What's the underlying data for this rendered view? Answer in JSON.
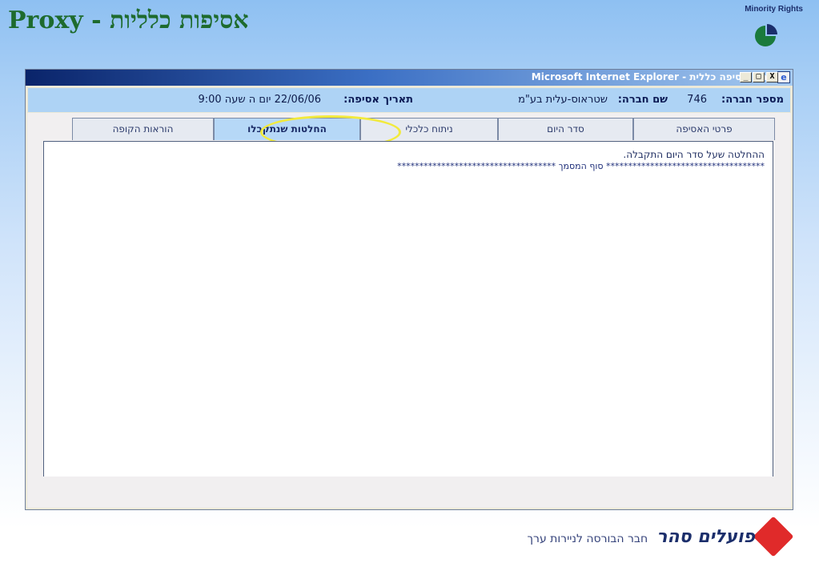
{
  "slide": {
    "title": "אסיפות כלליות - Proxy",
    "brand_label": "Minority Rights"
  },
  "window": {
    "title": "פרטי אסיפה כללית - Microsoft Internet Explorer",
    "minimize_glyph": "_",
    "maximize_glyph": "□",
    "close_glyph": "X"
  },
  "meeting": {
    "company_number_label": "מספר חברה:",
    "company_number": "746",
    "company_name_label": "שם חברה:",
    "company_name": "שטראוס-עלית בע\"מ",
    "meeting_date_label": "תאריך אסיפה:",
    "meeting_date": "22/06/06 יום ה שעה 9:00"
  },
  "tabs": [
    {
      "label": "פרטי האסיפה",
      "active": false
    },
    {
      "label": "סדר היום",
      "active": false
    },
    {
      "label": "ניתוח כלכלי",
      "active": false
    },
    {
      "label": "החלטות שנתקבלו",
      "active": true
    },
    {
      "label": "הוראות הקופה",
      "active": false
    }
  ],
  "content": {
    "line1": "ההחלטה שעל סדר היום התקבלה.",
    "line2": "************************************ סוף  המסמך ************************************"
  },
  "footer": {
    "bank_name": "פועלים סהר",
    "subtitle": "חבר הבורסה לניירות ערך"
  },
  "colors": {
    "title_green": "#1e6b2e",
    "highlight_yellow": "#f2ea3c",
    "logo_red": "#e02a2a",
    "brand_navy": "#1b2e6b"
  }
}
